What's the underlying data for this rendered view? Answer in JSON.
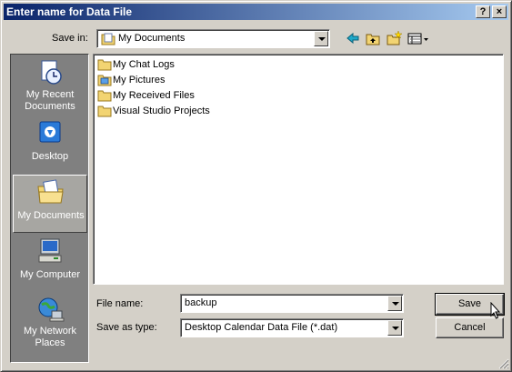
{
  "title": "Enter name for Data File",
  "title_buttons": {
    "help": "?",
    "close": "×"
  },
  "save_in": {
    "label": "Save in:",
    "value": "My Documents",
    "folder_icon": "my-documents-folder-icon"
  },
  "toolbar": {
    "back_icon": "back-arrow-icon",
    "up_icon": "up-folder-icon",
    "new_folder_icon": "new-folder-icon",
    "views_icon": "views-menu-icon"
  },
  "places": [
    {
      "label": "My Recent Documents",
      "icon": "recent-documents-icon",
      "active": false
    },
    {
      "label": "Desktop",
      "icon": "desktop-icon",
      "active": false
    },
    {
      "label": "My Documents",
      "icon": "my-documents-icon",
      "active": true
    },
    {
      "label": "My Computer",
      "icon": "my-computer-icon",
      "active": false
    },
    {
      "label": "My Network Places",
      "icon": "network-places-icon",
      "active": false
    }
  ],
  "files": [
    {
      "name": "My Chat Logs",
      "icon": "folder-icon"
    },
    {
      "name": "My Pictures",
      "icon": "pictures-folder-icon"
    },
    {
      "name": "My Received Files",
      "icon": "folder-icon"
    },
    {
      "name": "Visual Studio Projects",
      "icon": "folder-icon"
    }
  ],
  "file_name": {
    "label": "File name:",
    "value": "backup"
  },
  "save_as_type": {
    "label": "Save as type:",
    "value": "Desktop Calendar Data File (*.dat)"
  },
  "buttons": {
    "save": "Save",
    "cancel": "Cancel"
  },
  "colors": {
    "titlebar_start": "#0a246a",
    "titlebar_end": "#a6caf0",
    "face": "#d4d0c8",
    "places_bg": "#808080"
  }
}
